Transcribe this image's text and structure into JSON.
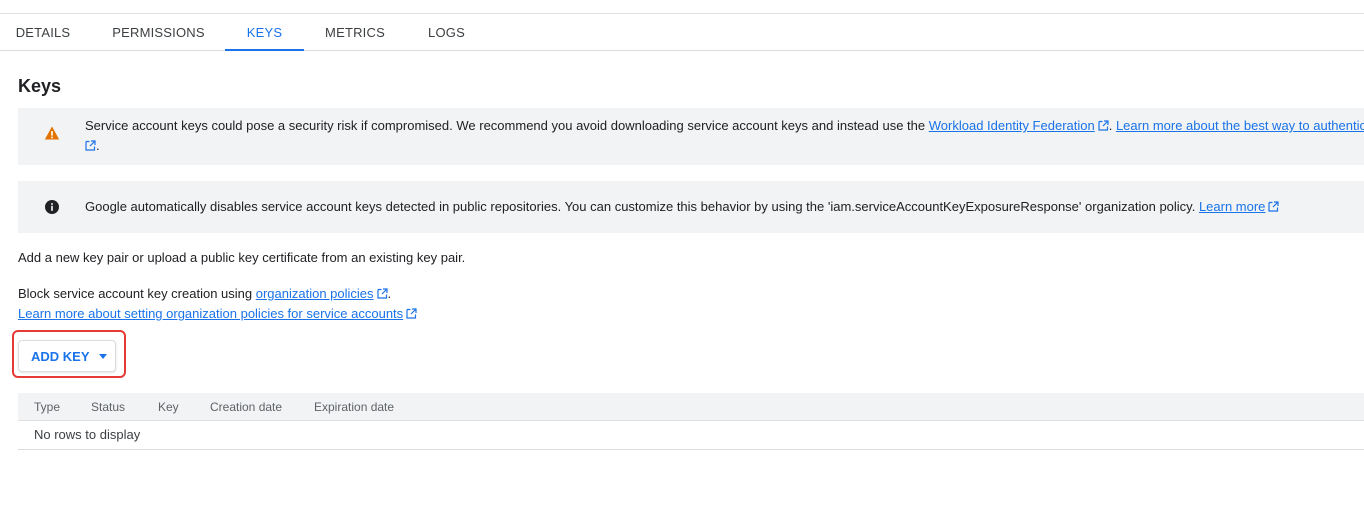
{
  "tabs": [
    {
      "label": "DETAILS",
      "active": false
    },
    {
      "label": "PERMISSIONS",
      "active": false
    },
    {
      "label": "KEYS",
      "active": true
    },
    {
      "label": "METRICS",
      "active": false
    },
    {
      "label": "LOGS",
      "active": false
    }
  ],
  "page_title": "Keys",
  "warning_banner": {
    "icon": "warning-triangle-icon",
    "icon_color": "#e37400",
    "text_before": "Service account keys could pose a security risk if compromised. We recommend you avoid downloading service account keys and instead use the ",
    "link1": "Workload Identity Federation",
    "between": ". ",
    "link2": "Learn more about the best way to authentic",
    "after": "."
  },
  "info_banner": {
    "icon": "info-icon",
    "text": "Google automatically disables service account keys detected in public repositories. You can customize this behavior by using the 'iam.serviceAccountKeyExposureResponse' organization policy. ",
    "link": "Learn more"
  },
  "add_key_description": "Add a new key pair or upload a public key certificate from an existing key pair.",
  "block_creation": {
    "text": "Block service account key creation using ",
    "link": "organization policies",
    "after": "."
  },
  "learn_more_policies_link": "Learn more about setting organization policies for service accounts",
  "add_key_button": {
    "label": "ADD KEY",
    "icon": "caret-down-icon"
  },
  "table": {
    "columns": [
      "Type",
      "Status",
      "Key",
      "Creation date",
      "Expiration date"
    ],
    "empty_message": "No rows to display"
  },
  "colors": {
    "accent": "#1a73e8",
    "highlight_outline": "#e53935",
    "banner_bg": "#f1f3f4"
  }
}
